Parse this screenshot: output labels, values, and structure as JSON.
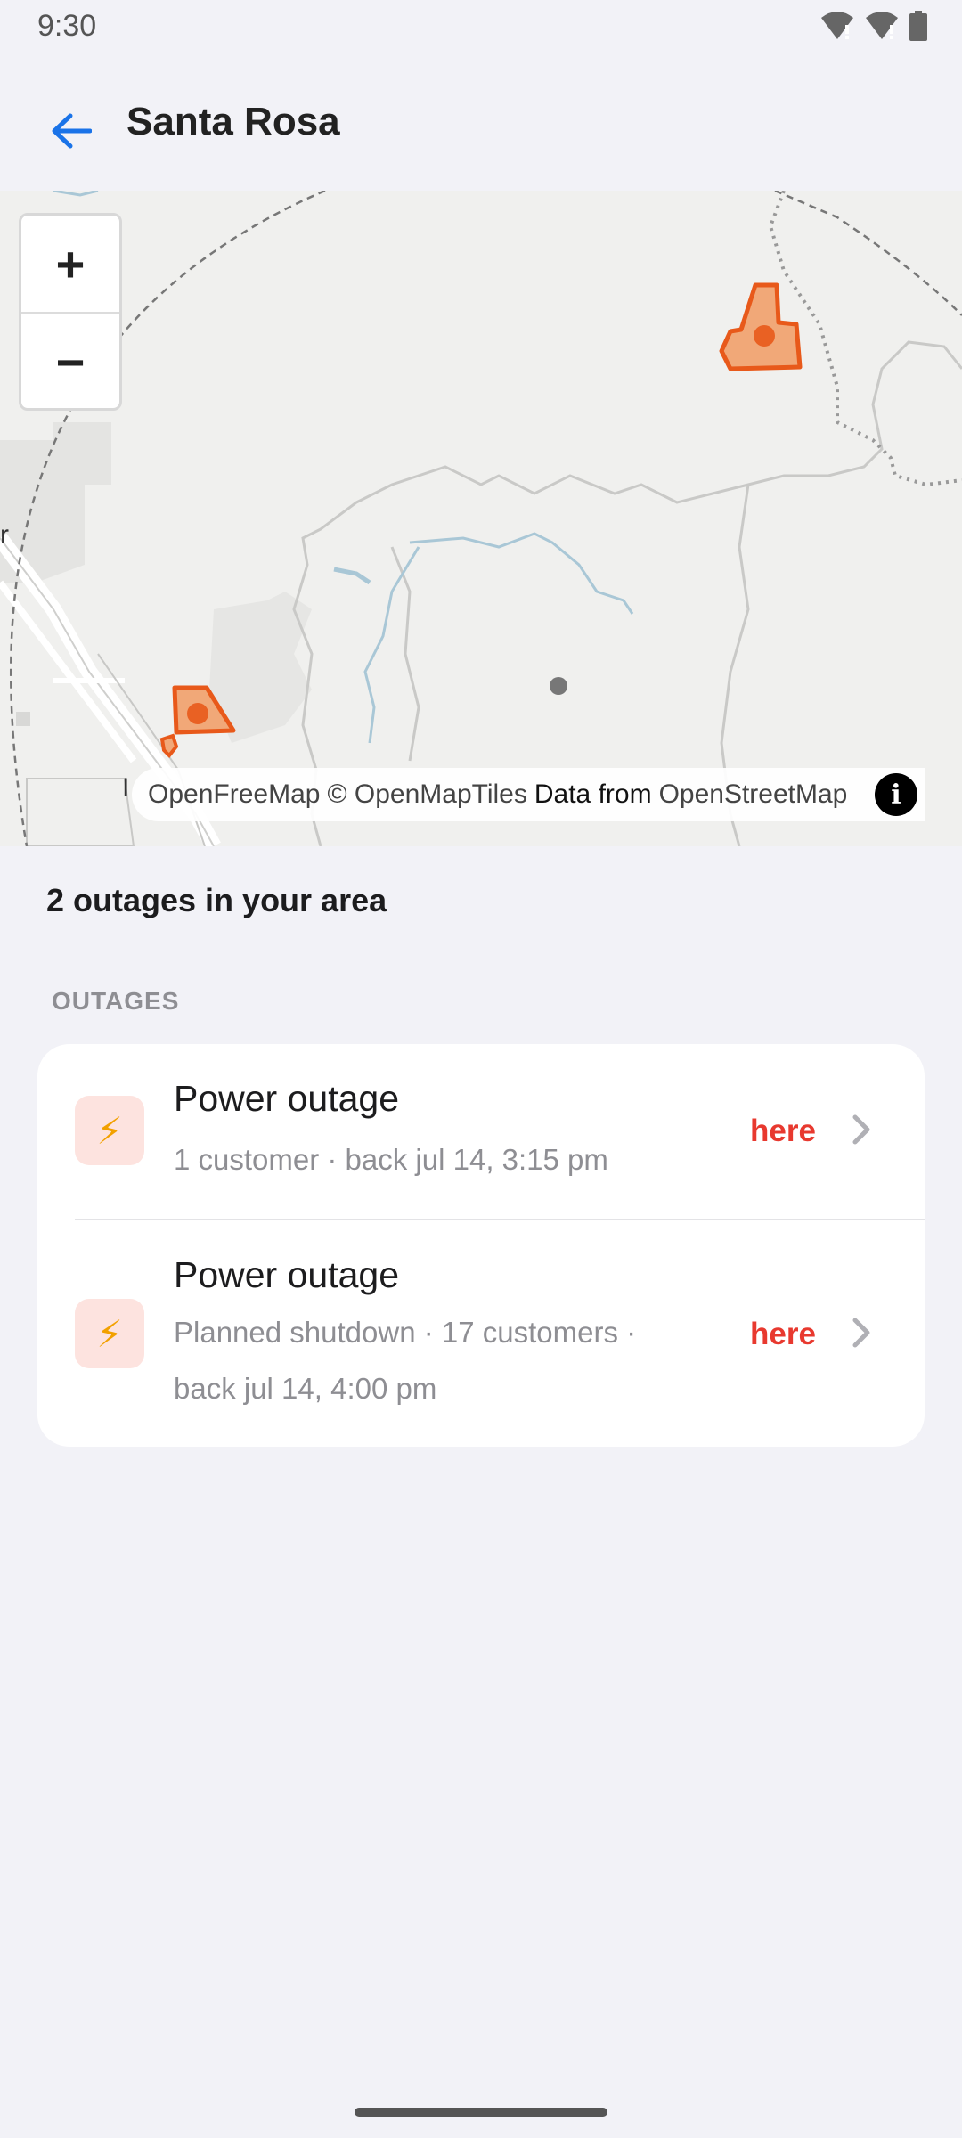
{
  "status_bar": {
    "time": "9:30",
    "icons": [
      "wifi-alert-icon",
      "signal-alert-icon",
      "battery-icon"
    ]
  },
  "header": {
    "back_icon": "arrow-left-icon",
    "title": "Santa Rosa"
  },
  "map": {
    "zoom_in_label": "+",
    "zoom_out_label": "−",
    "attribution": {
      "openfreemap": "OpenFreeMap",
      "openmaptiles": "© OpenMapTiles",
      "data_from": "Data from",
      "openstreetmap": "OpenStreetMap",
      "info_label": "i"
    },
    "edge_labels": {
      "left_letter": "r",
      "lower_letter": "I"
    },
    "outage_color": "#e8591a"
  },
  "summary": "2 outages in your area",
  "section_header": "OUTAGES",
  "outages": [
    {
      "icon": "lightning-bolt-icon",
      "title": "Power outage",
      "subtitle": "1 customer · back jul 14, 3:15 pm",
      "link": "here"
    },
    {
      "icon": "lightning-bolt-icon",
      "title": "Power outage",
      "subtitle": "Planned shutdown · 17 customers · back jul 14, 4:00 pm",
      "link": "here"
    }
  ],
  "colors": {
    "accent": "#1a73e8",
    "link_red": "#e8392f",
    "icon_bg": "#fde3df",
    "background": "#f2f2f7"
  }
}
